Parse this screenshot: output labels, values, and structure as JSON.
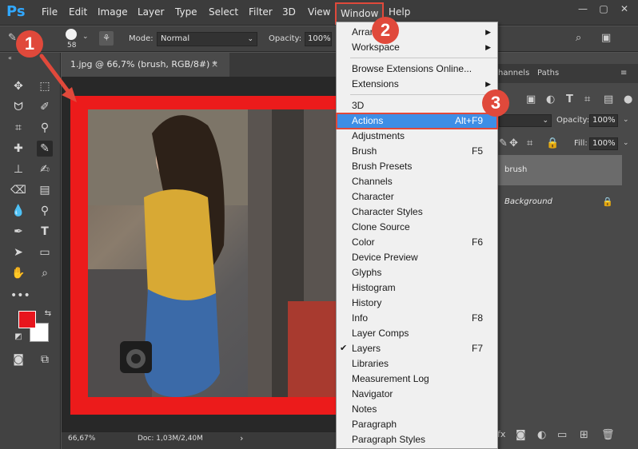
{
  "app": {
    "logo_text": "Ps"
  },
  "menubar": {
    "items": [
      "File",
      "Edit",
      "Image",
      "Layer",
      "Type",
      "Select",
      "Filter",
      "3D",
      "View",
      "Window",
      "Help"
    ]
  },
  "window_controls": {
    "minimize": "—",
    "restore": "▢",
    "close": "✕"
  },
  "options_bar": {
    "brush_size": "58",
    "mode_label": "Mode:",
    "mode_value": "Normal",
    "opacity_label": "Opacity:",
    "opacity_value": "100%"
  },
  "document": {
    "tab_title": "1.jpg @ 66,7% (brush, RGB/8#) *",
    "close_glyph": "×"
  },
  "status": {
    "zoom": "66,67%",
    "doc_size": "Doc: 1,03M/2,40M",
    "arrow": "›"
  },
  "panels": {
    "tabs": [
      "hannels",
      "Paths"
    ],
    "opacity_label": "Opacity:",
    "opacity_value": "100%",
    "fill_label": "Fill:",
    "fill_value": "100%",
    "layers": [
      {
        "name": "brush"
      },
      {
        "name": "Background"
      }
    ]
  },
  "window_menu": {
    "items": [
      {
        "label": "Arrange",
        "submenu": true
      },
      {
        "label": "Workspace",
        "submenu": true
      },
      {
        "label": "Browse Extensions Online..."
      },
      {
        "label": "Extensions",
        "submenu": true
      },
      {
        "label": "3D"
      },
      {
        "label": "Actions",
        "shortcut": "Alt+F9",
        "highlighted": true
      },
      {
        "label": "Adjustments"
      },
      {
        "label": "Brush",
        "shortcut": "F5"
      },
      {
        "label": "Brush Presets"
      },
      {
        "label": "Channels"
      },
      {
        "label": "Character"
      },
      {
        "label": "Character Styles"
      },
      {
        "label": "Clone Source"
      },
      {
        "label": "Color",
        "shortcut": "F6"
      },
      {
        "label": "Device Preview"
      },
      {
        "label": "Glyphs"
      },
      {
        "label": "Histogram"
      },
      {
        "label": "History"
      },
      {
        "label": "Info",
        "shortcut": "F8"
      },
      {
        "label": "Layer Comps"
      },
      {
        "label": "Layers",
        "shortcut": "F7",
        "checked": true
      },
      {
        "label": "Libraries"
      },
      {
        "label": "Measurement Log"
      },
      {
        "label": "Navigator"
      },
      {
        "label": "Notes"
      },
      {
        "label": "Paragraph"
      },
      {
        "label": "Paragraph Styles"
      }
    ]
  },
  "callouts": [
    "1",
    "2",
    "3"
  ],
  "colors": {
    "accent_red": "#e0493b",
    "highlight_blue": "#3d8ee6",
    "foreground_swatch": "#e8151d",
    "background_swatch": "#ffffff",
    "ps_blue": "#31a8ff"
  }
}
